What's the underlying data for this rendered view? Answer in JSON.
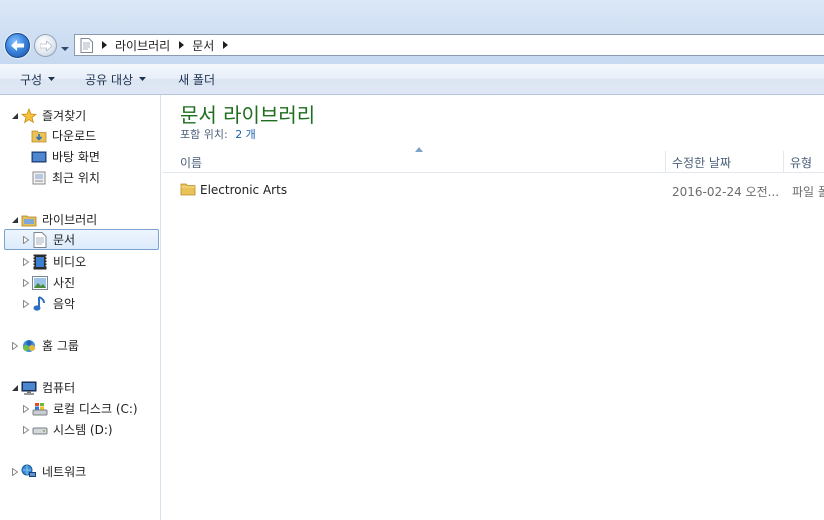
{
  "address_bar": {
    "crumbs": [
      "라이브러리",
      "문서"
    ]
  },
  "command_bar": {
    "organize": "구성",
    "share_with": "공유 대상",
    "new_folder": "새 폴더"
  },
  "nav_pane": {
    "favorites": {
      "label": "즐겨찾기",
      "items": [
        "다운로드",
        "바탕 화면",
        "최근 위치"
      ]
    },
    "libraries": {
      "label": "라이브러리",
      "items": [
        "문서",
        "비디오",
        "사진",
        "음악"
      ],
      "selected": "문서"
    },
    "homegroup": "홈 그룹",
    "computer": {
      "label": "컴퓨터",
      "items": [
        "로컬 디스크 (C:)",
        "시스템 (D:)"
      ]
    },
    "network": "네트워크"
  },
  "content": {
    "title": "문서 라이브러리",
    "includes_label": "포함 위치:",
    "includes_count": "2 개",
    "columns": [
      "이름",
      "수정한 날짜",
      "유형"
    ],
    "files": [
      {
        "name": "Electronic Arts",
        "modified": "2016-02-24 오전...",
        "type": "파일 폴더"
      }
    ]
  },
  "colors": {
    "title_green": "#1e6e1e",
    "link_blue": "#1a5fb4",
    "selection_border": "#7da2ce"
  }
}
